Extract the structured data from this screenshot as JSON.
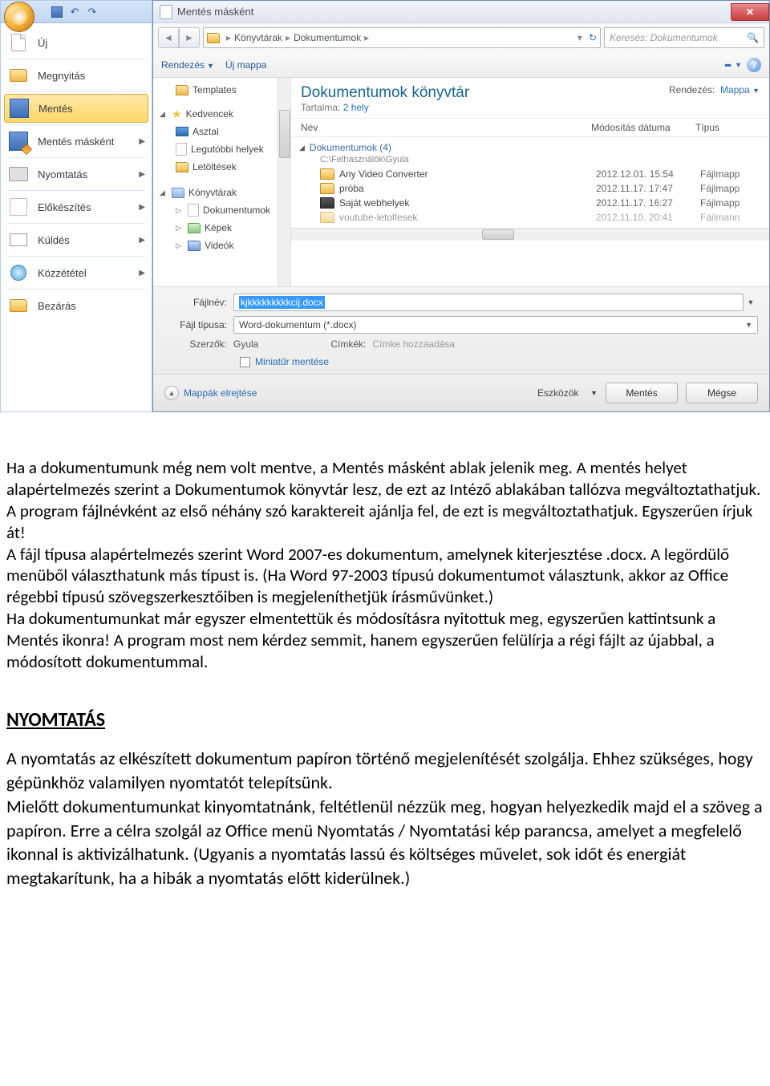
{
  "office_menu": {
    "items": [
      {
        "label": "Új",
        "icon": "page",
        "arrow": false
      },
      {
        "label": "Megnyitás",
        "icon": "folder",
        "arrow": false
      },
      {
        "label": "Mentés",
        "icon": "disk",
        "arrow": false,
        "selected": true
      },
      {
        "label": "Mentés másként",
        "icon": "disk-pen",
        "arrow": true
      },
      {
        "label": "Nyomtatás",
        "icon": "printer",
        "arrow": true
      },
      {
        "label": "Előkészítés",
        "icon": "brush",
        "arrow": true
      },
      {
        "label": "Küldés",
        "icon": "mail",
        "arrow": true
      },
      {
        "label": "Közzététel",
        "icon": "globe",
        "arrow": true
      },
      {
        "label": "Bezárás",
        "icon": "folder",
        "arrow": false
      }
    ]
  },
  "dialog": {
    "title": "Mentés másként",
    "breadcrumb": [
      "Könyvtárak",
      "Dokumentumok"
    ],
    "search_placeholder": "Keresés: Dokumentumok",
    "toolbar": {
      "arrange": "Rendezés",
      "new_folder": "Új mappa"
    },
    "tree": {
      "templates": "Templates",
      "favorites": "Kedvencek",
      "desktop": "Asztal",
      "recent": "Legutóbbi helyek",
      "downloads": "Letöltések",
      "libraries": "Könyvtárak",
      "documents": "Dokumentumok",
      "pictures": "Képek",
      "videos": "Videók"
    },
    "library": {
      "title": "Dokumentumok könyvtár",
      "contains_label": "Tartalma:",
      "contains_value": "2 hely",
      "sort_label": "Rendezés:",
      "sort_value": "Mappa"
    },
    "columns": {
      "name": "Név",
      "date": "Módosítás dátuma",
      "type": "Típus"
    },
    "group": {
      "name": "Dokumentumok (4)",
      "path": "C:\\Felhasználók\\Gyula"
    },
    "files": [
      {
        "name": "Any Video Converter",
        "date": "2012.12.01. 15:54",
        "type": "Fájlmapp"
      },
      {
        "name": "próba",
        "date": "2012.11.17. 17:47",
        "type": "Fájlmapp"
      },
      {
        "name": "Saját webhelyek",
        "date": "2012.11.17. 16:27",
        "type": "Fájlmapp",
        "dark": true
      },
      {
        "name": "voutube-letoltesek",
        "date": "2012.11.10. 20:41",
        "type": "Fáilmann",
        "fade": true
      }
    ],
    "form": {
      "filename_label": "Fájlnév:",
      "filename_value": "kjkkkkkkkkkcij.docx",
      "filetype_label": "Fájl típusa:",
      "filetype_value": "Word-dokumentum (*.docx)",
      "author_label": "Szerzők:",
      "author_value": "Gyula",
      "tags_label": "Címkék:",
      "tags_placeholder": "Címke hozzáadása",
      "thumbnail_label": "Miniatűr mentése"
    },
    "footer": {
      "hide_folders": "Mappák elrejtése",
      "tools": "Eszközök",
      "save": "Mentés",
      "cancel": "Mégse"
    }
  },
  "doc": {
    "p1": "Ha a dokumentumunk még nem volt mentve, a Mentés másként ablak jelenik meg. A mentés helyet alapértelmezés szerint a Dokumentumok könyvtár lesz, de ezt az Intéző ablakában tallózva megváltoztathatjuk. A program fájlnévként az első néhány szó karaktereit ajánlja fel, de ezt is megváltoztathatjuk. Egyszerűen írjuk át!",
    "p2": "A fájl típusa alapértelmezés szerint Word 2007-es dokumentum, amelynek kiterjesztése .docx. A legördülő menüből választhatunk más típust is. (Ha Word 97-2003 típusú dokumentumot választunk, akkor az Office régebbi típusú szövegszerkesztőiben is megjeleníthetjük írásművünket.)",
    "p3": "Ha dokumentumunkat már egyszer elmentettük és módosításra nyitottuk meg, egyszerűen kattintsunk a Mentés ikonra! A program most nem kérdez semmit, hanem egyszerűen felülírja a régi fájlt az újabbal, a módosított dokumentummal.",
    "h3": "NYOMTATÁS",
    "h3p1": "A nyomtatás az elkészített dokumentum papíron történő megjelenítését szolgálja. Ehhez szükséges, hogy gépünkhöz valamilyen nyomtatót telepítsünk.",
    "h3p2": "Mielőtt dokumentumunkat kinyomtatnánk, feltétlenül nézzük meg, hogyan helyezkedik majd el a szöveg a papíron. Erre a célra szolgál az Office menü Nyomtatás / Nyomtatási kép parancsa, amelyet a megfelelő ikonnal is aktivizálhatunk. (Ugyanis a nyomtatás lassú és költséges művelet, sok időt és energiát megtakarítunk, ha a hibák a nyomtatás előtt kiderülnek.)"
  }
}
